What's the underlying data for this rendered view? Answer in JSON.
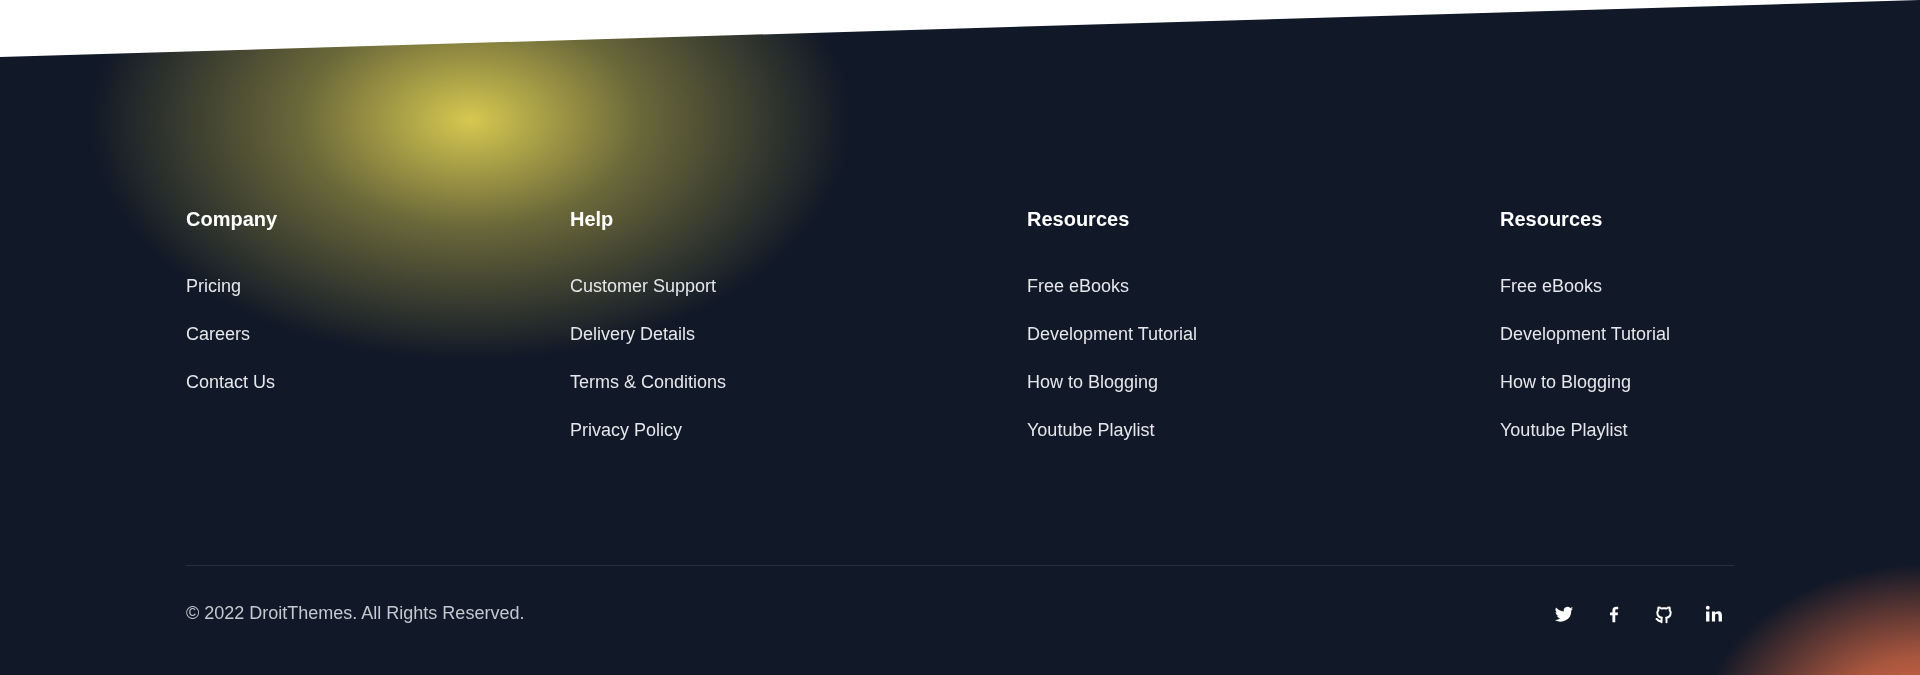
{
  "columns": [
    {
      "heading": "Company",
      "links": [
        "Pricing",
        "Careers",
        "Contact Us"
      ]
    },
    {
      "heading": "Help",
      "links": [
        "Customer Support",
        "Delivery Details",
        "Terms & Conditions",
        "Privacy Policy"
      ]
    },
    {
      "heading": "Resources",
      "links": [
        "Free eBooks",
        "Development Tutorial",
        "How to Blogging",
        "Youtube Playlist"
      ]
    },
    {
      "heading": "Resources",
      "links": [
        "Free eBooks",
        "Development Tutorial",
        "How to Blogging",
        "Youtube Playlist"
      ]
    }
  ],
  "copyright": "© 2022 DroitThemes. All Rights Reserved.",
  "social": [
    {
      "kind": "twitter"
    },
    {
      "kind": "facebook"
    },
    {
      "kind": "github"
    },
    {
      "kind": "linkedin"
    }
  ]
}
